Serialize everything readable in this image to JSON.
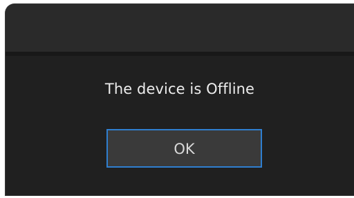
{
  "dialog": {
    "message": "The device is Offline",
    "ok_label": "OK"
  },
  "colors": {
    "dialog_bg": "#202020",
    "title_bar_bg": "#2a2a2a",
    "button_bg": "#3a3a3a",
    "focus_border": "#2f7fd0",
    "text": "#ededed"
  }
}
